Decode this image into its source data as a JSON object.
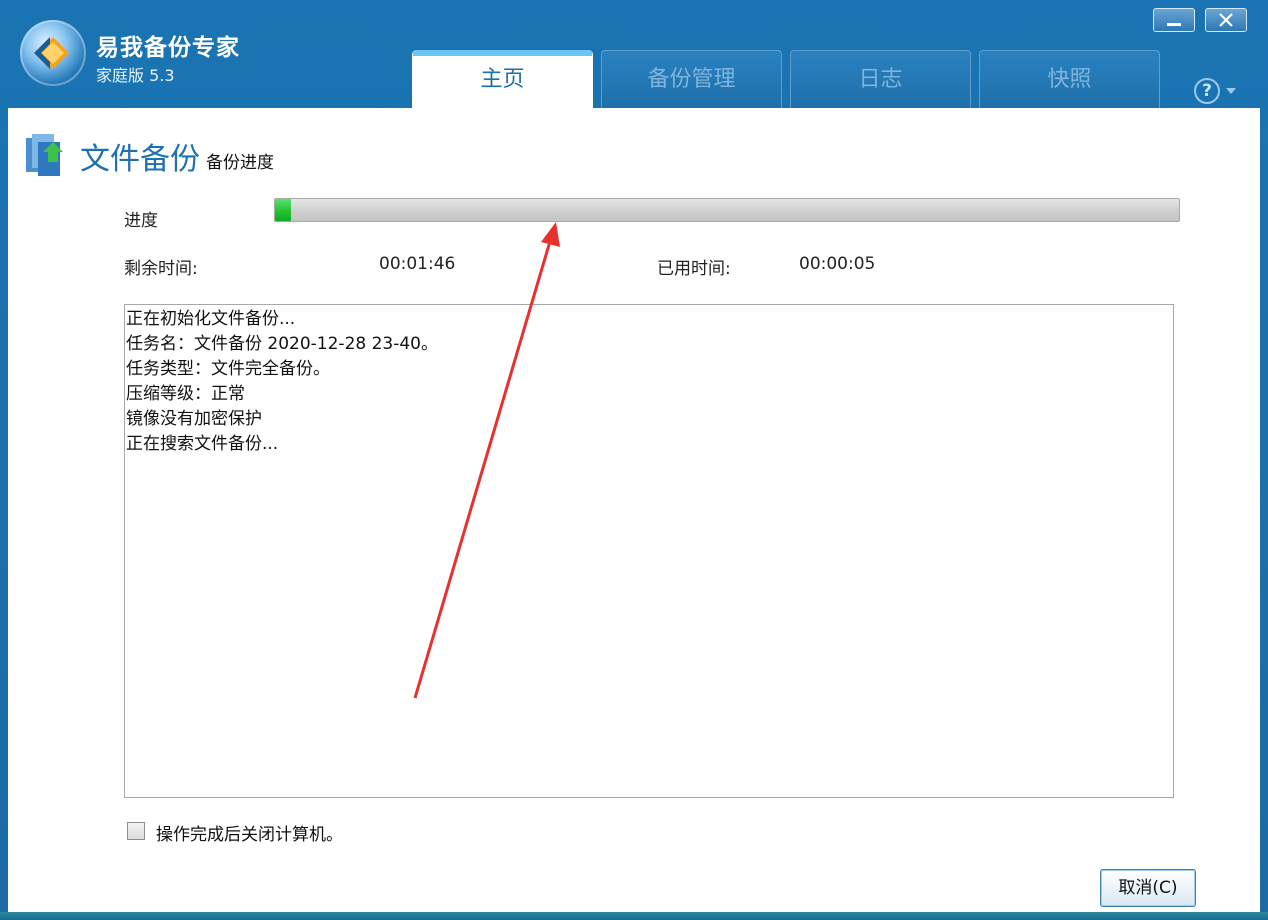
{
  "app": {
    "title": "易我备份专家",
    "edition": "家庭版 5.3"
  },
  "tabs": [
    {
      "label": "主页",
      "active": true
    },
    {
      "label": "备份管理",
      "active": false
    },
    {
      "label": "日志",
      "active": false
    },
    {
      "label": "快照",
      "active": false
    }
  ],
  "help": {
    "glyph": "?"
  },
  "section": {
    "title": "文件备份",
    "subtitle": "备份进度"
  },
  "progress": {
    "label": "进度",
    "fraction": 0.018,
    "remaining_label": "剩余时间:",
    "remaining_value": "00:01:46",
    "elapsed_label": "已用时间:",
    "elapsed_value": "00:00:05"
  },
  "log": {
    "lines": [
      "正在初始化文件备份...",
      "任务名：文件备份 2020-12-28 23-40。",
      "任务类型：文件完全备份。",
      "压缩等级：正常",
      "镜像没有加密保护",
      "正在搜索文件备份..."
    ]
  },
  "shutdown_option": {
    "label": "操作完成后关闭计算机。",
    "checked": false
  },
  "cancel_button": {
    "label": "取消(C)"
  },
  "colors": {
    "window_blue": "#1d6fa9",
    "title_blue": "#1f6fb3",
    "progress_green": "#1fc12f",
    "annotation_red": "#e8312f"
  }
}
